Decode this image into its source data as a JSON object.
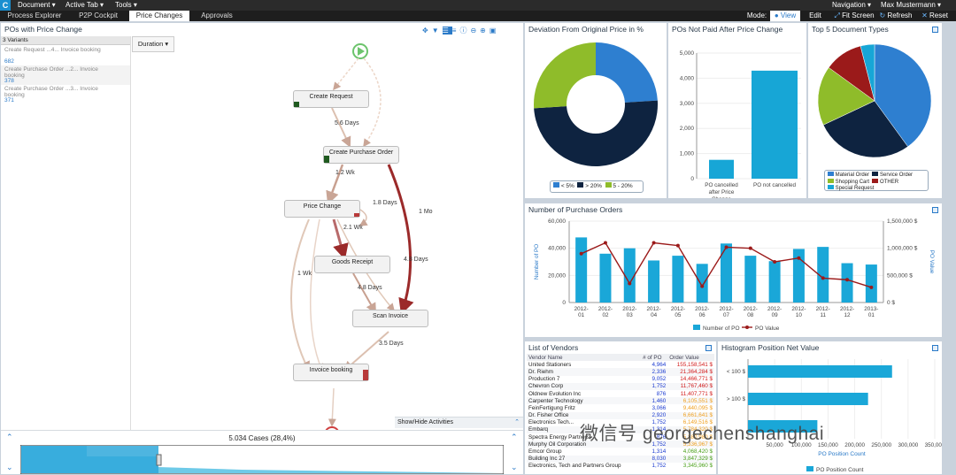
{
  "menu": {
    "logo": "C",
    "document": "Document ▾",
    "active_tab": "Active Tab ▾",
    "tools": "Tools ▾",
    "navigation": "Navigation ▾",
    "user": "Max Mustermann ▾"
  },
  "tabs": [
    {
      "label": "Process Explorer"
    },
    {
      "label": "P2P Cockpit"
    },
    {
      "label": "Price Changes"
    },
    {
      "label": "Approvals"
    }
  ],
  "mode": {
    "label": "Mode:",
    "view": "View",
    "edit": "Edit",
    "fit": "Fit Screen",
    "refresh": "Refresh",
    "reset": "Reset"
  },
  "variants_panel": {
    "title": "POs with Price Change",
    "count": "3 Variants",
    "duration_btn": "Duration ▾",
    "items": [
      {
        "text": "Create Request ...4... Invoice booking",
        "num": "682"
      },
      {
        "text": "Create Purchase Order ...2... Invoice booking",
        "num": "378"
      },
      {
        "text": "Create Purchase Order ...3... Invoice booking",
        "num": "371"
      }
    ]
  },
  "process": {
    "nodes": {
      "n1": "Create Request",
      "n2": "Create Purchase Order",
      "n3": "Price Change",
      "n4": "Goods Receipt",
      "n5": "Scan Invoice",
      "n6": "Invoice booking"
    },
    "edges": {
      "e1": "5.6 Days",
      "e2": "1.2 Wk",
      "e3": "1.8 Days",
      "e4": "2.1 Wk",
      "e5": "1 Mo",
      "e6": "4.8 Days",
      "e7": "4.8 Days",
      "e8": "1 Wk",
      "e9": "3.5 Days"
    },
    "show_hide": "Show/Hide Activities",
    "cases": "5.034 Cases (28,4%)"
  },
  "donut": {
    "title": "Deviation From Original Price in %",
    "legend": [
      "< 5%",
      "> 20%",
      "5 - 20%"
    ],
    "colors": [
      "#2e7fd0",
      "#0e2340",
      "#8fbc2a"
    ],
    "values": [
      24,
      50,
      26
    ]
  },
  "notpaid": {
    "title": "POs Not Paid After Price Change",
    "yticks": [
      "5,000",
      "4,000",
      "3,000",
      "2,000",
      "1,000",
      "0"
    ],
    "categories": [
      "PO cancelled after Price Change",
      "PO not cancelled"
    ],
    "values": [
      750,
      4300
    ]
  },
  "top5": {
    "title": "Top 5 Document Types",
    "legend": [
      "Material Order",
      "Service Order",
      "Shopping Cart",
      "OTHER",
      "Special Request"
    ],
    "colors": [
      "#2e7fd0",
      "#0e2340",
      "#8fbc2a",
      "#9b1a1a",
      "#17a6d6"
    ],
    "values": [
      40,
      28,
      17,
      11,
      4
    ]
  },
  "npo": {
    "title": "Number of Purchase Orders",
    "left_ticks": [
      "60,000",
      "40,000",
      "20,000",
      "0"
    ],
    "right_ticks": [
      "1,500,000 $",
      "1,000,000 $",
      "500,000 $",
      "0 $"
    ],
    "left_label": "Number of PO",
    "right_label": "PO Value",
    "x_top": [
      "2012-",
      "2012-",
      "2012-",
      "2012-",
      "2012-",
      "2012-",
      "2012-",
      "2012-",
      "2012-",
      "2012-",
      "2012-",
      "2012-",
      "2013-"
    ],
    "x_bot": [
      "01",
      "02",
      "03",
      "04",
      "05",
      "06",
      "07",
      "08",
      "09",
      "10",
      "11",
      "12",
      "01"
    ],
    "legend_po": "Number of PO",
    "legend_val": "PO Value"
  },
  "chart_data": [
    {
      "type": "bar",
      "title": "POs Not Paid After Price Change",
      "categories": [
        "PO cancelled after Price Change",
        "PO not cancelled"
      ],
      "values": [
        750,
        4300
      ],
      "ylim": [
        0,
        5000
      ]
    },
    {
      "type": "bar",
      "title": "Number of Purchase Orders",
      "categories": [
        "2012-01",
        "2012-02",
        "2012-03",
        "2012-04",
        "2012-05",
        "2012-06",
        "2012-07",
        "2012-08",
        "2012-09",
        "2012-10",
        "2012-11",
        "2012-12",
        "2013-01"
      ],
      "series": [
        {
          "name": "Number of PO",
          "values": [
            48000,
            36000,
            40000,
            31000,
            34500,
            28500,
            43500,
            34500,
            30500,
            39500,
            41000,
            29000,
            28000
          ]
        },
        {
          "name": "PO Value",
          "values": [
            900000,
            1100000,
            350000,
            1100000,
            1050000,
            300000,
            1020000,
            1000000,
            750000,
            820000,
            450000,
            420000,
            280000
          ]
        }
      ],
      "ylim": [
        0,
        60000
      ],
      "y2lim": [
        0,
        1500000
      ]
    },
    {
      "type": "bar",
      "title": "Histogram Position Net Value",
      "categories": [
        "< 100 $",
        "> 100 $",
        ""
      ],
      "values": [
        270000,
        225000,
        130000
      ],
      "xlim": [
        0,
        350000
      ],
      "xlabel": "PO Position Count"
    }
  ],
  "vendors": {
    "title": "List of Vendors",
    "headers": [
      "Vendor Name",
      "# of PO",
      "Order Value"
    ],
    "rows": [
      [
        "United Stationers",
        "4,964",
        "155,158,541 $",
        "#d21a1a"
      ],
      [
        "Dr. Riehm",
        "2,336",
        "21,364,284 $",
        "#d21a1a"
      ],
      [
        "Production 7",
        "9,052",
        "14,466,771 $",
        "#d21a1a"
      ],
      [
        "Chevron Corp",
        "1,752",
        "11,767,460 $",
        "#d21a1a"
      ],
      [
        "Oldnew Evolution Inc",
        "876",
        "11,407,771 $",
        "#d21a1a"
      ],
      [
        "Carpenter Technology",
        "1,460",
        "6,105,551 $",
        "#f0a020"
      ],
      [
        "FeinFertigung Fritz",
        "3,066",
        "9,440,095 $",
        "#f0a020"
      ],
      [
        "Dr. Fisher Office",
        "2,920",
        "6,661,641 $",
        "#f0a020"
      ],
      [
        "Electronics Tech...",
        "1,752",
        "6,149,516 $",
        "#f0a020"
      ],
      [
        "Embarq",
        "1,314",
        "5,784,320 $",
        "#f0a020"
      ],
      [
        "Spectra Energy Partners",
        "876",
        "5,380,980 $",
        "#f0a020"
      ],
      [
        "Murphy Oil Corporation",
        "1,752",
        "5,336,967 $",
        "#f0a020"
      ],
      [
        "Emcor Group",
        "1,314",
        "4,068,420 $",
        "#4aa01a"
      ],
      [
        "Building Inc 27",
        "8,030",
        "3,847,329 $",
        "#4aa01a"
      ],
      [
        "Electronics, Tech and Partners Group",
        "1,752",
        "3,345,960 $",
        "#4aa01a"
      ]
    ]
  },
  "histogram": {
    "title": "Histogram Position Net Value",
    "cats": [
      "< 100 $",
      "> 100 $"
    ],
    "xticks": [
      "50,000",
      "100,000",
      "150,000",
      "200,000",
      "250,000",
      "300,000",
      "350,000"
    ],
    "xlabel": "PO Position Count",
    "legend": "PO Position Count"
  },
  "watermark": "微信号 georgechenshanghai"
}
